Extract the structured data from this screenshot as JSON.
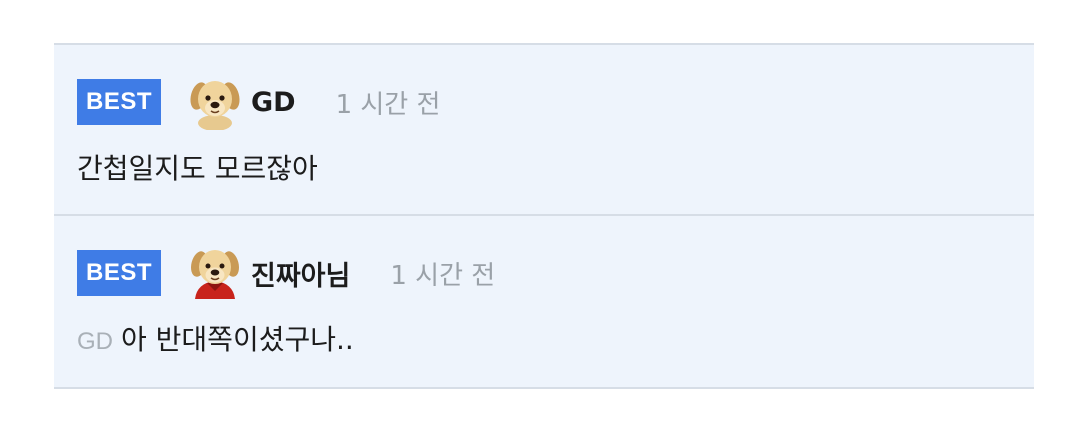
{
  "comments": [
    {
      "badge": "BEST",
      "avatar_icon": "puppy-icon",
      "username": "GD",
      "time": "1 시간 전",
      "mention": "",
      "text": "간첩일지도 모르잖아"
    },
    {
      "badge": "BEST",
      "avatar_icon": "puppy-cape-icon",
      "username": "진짜아님",
      "time": "1 시간 전",
      "mention": "GD",
      "text": "아 반대쪽이셨구나.."
    }
  ],
  "colors": {
    "badge_bg": "#3f7ce6",
    "comment_bg": "#eef4fc",
    "time_text": "#9aa1a8",
    "mention_text": "#a9b0b7"
  }
}
